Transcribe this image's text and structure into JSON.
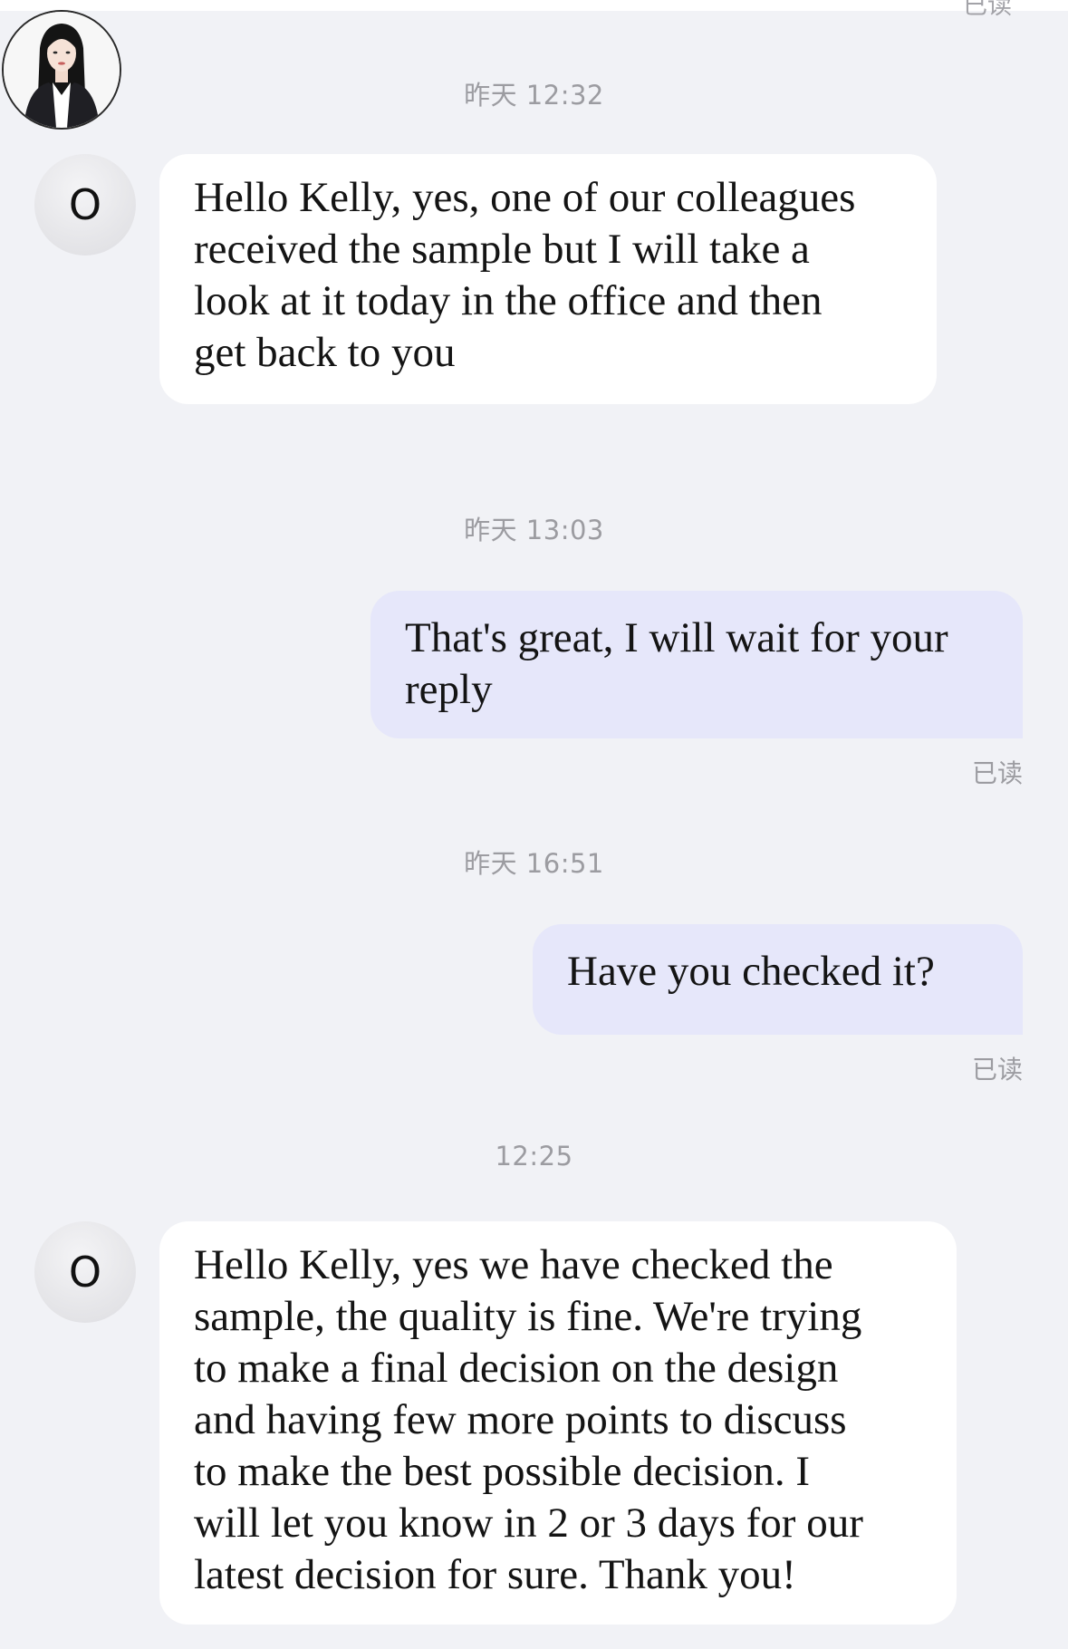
{
  "status": {
    "read_label": "已读"
  },
  "messages": [
    {
      "time": "昨天 12:32",
      "sender": "contact",
      "avatar_letter": "O",
      "text": "Hello Kelly, yes, one of our colleagues\nreceived the sample but I will take a\nlook at it today in the office and then\nget back to you"
    },
    {
      "time": "昨天 13:03",
      "sender": "me",
      "text": "That's great, I will wait for your\nreply",
      "status": "已读"
    },
    {
      "time": "昨天 16:51",
      "sender": "me",
      "text": "Have you checked it?",
      "status": "已读"
    },
    {
      "time": "12:25",
      "sender": "contact",
      "avatar_letter": "O",
      "text": "Hello Kelly, yes we have checked the\nsample, the quality is fine.  We're trying\nto make a final decision on the design\nand having few more points to discuss\nto make the best possible decision. I\nwill let you know in 2 or 3 days for our\nlatest decision for sure. Thank you!"
    }
  ],
  "colors": {
    "background": "#f1f2f6",
    "incoming_bubble": "#ffffff",
    "outgoing_bubble": "#e6e7fa",
    "meta_text": "#9c9ca1"
  }
}
